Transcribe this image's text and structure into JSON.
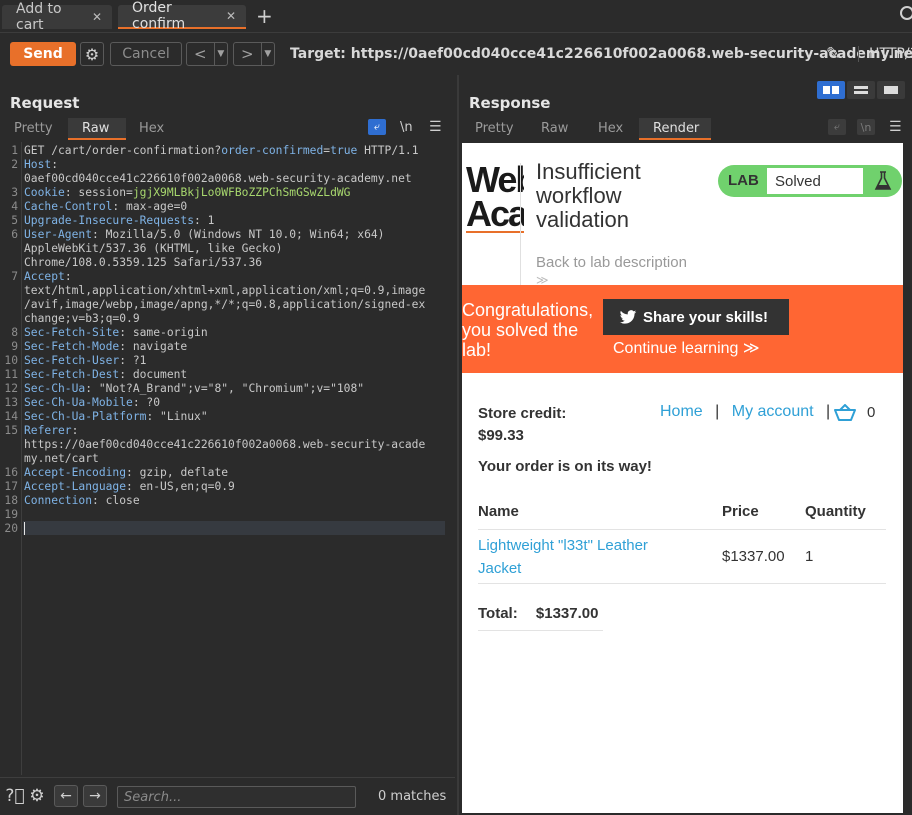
{
  "tabs": [
    {
      "label": "Add to cart"
    },
    {
      "label": "Order confirm"
    }
  ],
  "toolbar": {
    "send": "Send",
    "cancel": "Cancel",
    "prev": "<",
    "next": ">",
    "target": "Target: https://0aef00cd040cce41c226610f002a0068.web-security-academy.net",
    "http": "HTTP/1"
  },
  "request": {
    "title": "Request",
    "tabs": [
      "Pretty",
      "Raw",
      "Hex"
    ],
    "active_tab": "Raw",
    "lines": [
      {
        "n": "1",
        "parts": [
          [
            "t",
            "GET /cart/order-confirmation?"
          ],
          [
            "v",
            "order-confirmed"
          ],
          [
            "t",
            "="
          ],
          [
            "v",
            "true"
          ],
          [
            "t",
            " HTTP/1.1"
          ]
        ]
      },
      {
        "n": "2",
        "parts": [
          [
            "k",
            "Host"
          ],
          [
            "t",
            ":"
          ]
        ]
      },
      {
        "n": "",
        "parts": [
          [
            "t",
            "0aef00cd040cce41c226610f002a0068.web-security-academy.net"
          ]
        ]
      },
      {
        "n": "3",
        "parts": [
          [
            "k",
            "Cookie"
          ],
          [
            "t",
            ": "
          ],
          [
            "t",
            "session"
          ],
          [
            "t",
            "="
          ],
          [
            "c",
            "jgjX9MLBkjLo0WFBoZZPChSmGSwZLdWG"
          ]
        ]
      },
      {
        "n": "4",
        "parts": [
          [
            "k",
            "Cache-Control"
          ],
          [
            "t",
            ": max-age=0"
          ]
        ]
      },
      {
        "n": "5",
        "parts": [
          [
            "k",
            "Upgrade-Insecure-Requests"
          ],
          [
            "t",
            ": 1"
          ]
        ]
      },
      {
        "n": "6",
        "parts": [
          [
            "k",
            "User-Agent"
          ],
          [
            "t",
            ": Mozilla/5.0 (Windows NT 10.0; Win64; x64)"
          ]
        ]
      },
      {
        "n": "",
        "parts": [
          [
            "t",
            "AppleWebKit/537.36 (KHTML, like Gecko)"
          ]
        ]
      },
      {
        "n": "",
        "parts": [
          [
            "t",
            "Chrome/108.0.5359.125 Safari/537.36"
          ]
        ]
      },
      {
        "n": "7",
        "parts": [
          [
            "k",
            "Accept"
          ],
          [
            "t",
            ":"
          ]
        ]
      },
      {
        "n": "",
        "parts": [
          [
            "t",
            "text/html,application/xhtml+xml,application/xml;q=0.9,image"
          ]
        ]
      },
      {
        "n": "",
        "parts": [
          [
            "t",
            "/avif,image/webp,image/apng,*/*;q=0.8,application/signed-ex"
          ]
        ]
      },
      {
        "n": "",
        "parts": [
          [
            "t",
            "change;v=b3;q=0.9"
          ]
        ]
      },
      {
        "n": "8",
        "parts": [
          [
            "k",
            "Sec-Fetch-Site"
          ],
          [
            "t",
            ": same-origin"
          ]
        ]
      },
      {
        "n": "9",
        "parts": [
          [
            "k",
            "Sec-Fetch-Mode"
          ],
          [
            "t",
            ": navigate"
          ]
        ]
      },
      {
        "n": "10",
        "parts": [
          [
            "k",
            "Sec-Fetch-User"
          ],
          [
            "t",
            ": ?1"
          ]
        ]
      },
      {
        "n": "11",
        "parts": [
          [
            "k",
            "Sec-Fetch-Dest"
          ],
          [
            "t",
            ": document"
          ]
        ]
      },
      {
        "n": "12",
        "parts": [
          [
            "k",
            "Sec-Ch-Ua"
          ],
          [
            "t",
            ": \"Not?A_Brand\";v=\"8\", \"Chromium\";v=\"108\""
          ]
        ]
      },
      {
        "n": "13",
        "parts": [
          [
            "k",
            "Sec-Ch-Ua-Mobile"
          ],
          [
            "t",
            ": ?0"
          ]
        ]
      },
      {
        "n": "14",
        "parts": [
          [
            "k",
            "Sec-Ch-Ua-Platform"
          ],
          [
            "t",
            ": \"Linux\""
          ]
        ]
      },
      {
        "n": "15",
        "parts": [
          [
            "k",
            "Referer"
          ],
          [
            "t",
            ":"
          ]
        ]
      },
      {
        "n": "",
        "parts": [
          [
            "t",
            "https://0aef00cd040cce41c226610f002a0068.web-security-acade"
          ]
        ]
      },
      {
        "n": "",
        "parts": [
          [
            "t",
            "my.net/cart"
          ]
        ]
      },
      {
        "n": "16",
        "parts": [
          [
            "k",
            "Accept-Encoding"
          ],
          [
            "t",
            ": gzip, deflate"
          ]
        ]
      },
      {
        "n": "17",
        "parts": [
          [
            "k",
            "Accept-Language"
          ],
          [
            "t",
            ": en-US,en;q=0.9"
          ]
        ]
      },
      {
        "n": "18",
        "parts": [
          [
            "k",
            "Connection"
          ],
          [
            "t",
            ": close"
          ]
        ]
      },
      {
        "n": "19",
        "parts": []
      },
      {
        "n": "20",
        "parts": []
      }
    ],
    "search_placeholder": "Search...",
    "matches": "0 matches"
  },
  "response": {
    "title": "Response",
    "tabs": [
      "Pretty",
      "Raw",
      "Hex",
      "Render"
    ],
    "active_tab": "Render"
  },
  "render": {
    "logo_line1": "Web",
    "logo_line2": "Academy",
    "lab_title": "Insufficient workflow validation",
    "lab_label": "LAB",
    "lab_status": "Solved",
    "back_link": "Back to lab description",
    "congrats": "Congratulations, you solved the lab!",
    "share": "Share your skills!",
    "continue": "Continue learning",
    "store_credit_label": "Store credit:",
    "store_credit_value": "$99.33",
    "nav_home": "Home",
    "nav_account": "My account",
    "nav_sep": "|",
    "cart_count": "0",
    "order_msg": "Your order is on its way!",
    "table_headers": [
      "Name",
      "Price",
      "Quantity"
    ],
    "product_name": "Lightweight \"l33t\" Leather Jacket",
    "product_price": "$1337.00",
    "product_qty": "1",
    "total_label": "Total:",
    "total_value": "$1337.00",
    "colors": {
      "accent": "#e8702a",
      "banner": "#ff6633",
      "lab_green": "#70d16d",
      "link": "#2fa0d6"
    }
  }
}
